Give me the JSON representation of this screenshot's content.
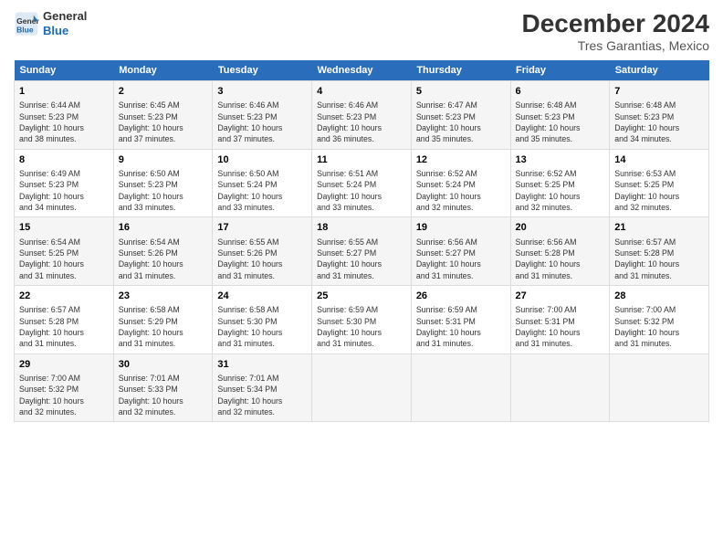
{
  "logo": {
    "line1": "General",
    "line2": "Blue"
  },
  "title": "December 2024",
  "subtitle": "Tres Garantias, Mexico",
  "weekdays": [
    "Sunday",
    "Monday",
    "Tuesday",
    "Wednesday",
    "Thursday",
    "Friday",
    "Saturday"
  ],
  "weeks": [
    [
      {
        "day": "1",
        "info": "Sunrise: 6:44 AM\nSunset: 5:23 PM\nDaylight: 10 hours\nand 38 minutes."
      },
      {
        "day": "2",
        "info": "Sunrise: 6:45 AM\nSunset: 5:23 PM\nDaylight: 10 hours\nand 37 minutes."
      },
      {
        "day": "3",
        "info": "Sunrise: 6:46 AM\nSunset: 5:23 PM\nDaylight: 10 hours\nand 37 minutes."
      },
      {
        "day": "4",
        "info": "Sunrise: 6:46 AM\nSunset: 5:23 PM\nDaylight: 10 hours\nand 36 minutes."
      },
      {
        "day": "5",
        "info": "Sunrise: 6:47 AM\nSunset: 5:23 PM\nDaylight: 10 hours\nand 35 minutes."
      },
      {
        "day": "6",
        "info": "Sunrise: 6:48 AM\nSunset: 5:23 PM\nDaylight: 10 hours\nand 35 minutes."
      },
      {
        "day": "7",
        "info": "Sunrise: 6:48 AM\nSunset: 5:23 PM\nDaylight: 10 hours\nand 34 minutes."
      }
    ],
    [
      {
        "day": "8",
        "info": "Sunrise: 6:49 AM\nSunset: 5:23 PM\nDaylight: 10 hours\nand 34 minutes."
      },
      {
        "day": "9",
        "info": "Sunrise: 6:50 AM\nSunset: 5:23 PM\nDaylight: 10 hours\nand 33 minutes."
      },
      {
        "day": "10",
        "info": "Sunrise: 6:50 AM\nSunset: 5:24 PM\nDaylight: 10 hours\nand 33 minutes."
      },
      {
        "day": "11",
        "info": "Sunrise: 6:51 AM\nSunset: 5:24 PM\nDaylight: 10 hours\nand 33 minutes."
      },
      {
        "day": "12",
        "info": "Sunrise: 6:52 AM\nSunset: 5:24 PM\nDaylight: 10 hours\nand 32 minutes."
      },
      {
        "day": "13",
        "info": "Sunrise: 6:52 AM\nSunset: 5:25 PM\nDaylight: 10 hours\nand 32 minutes."
      },
      {
        "day": "14",
        "info": "Sunrise: 6:53 AM\nSunset: 5:25 PM\nDaylight: 10 hours\nand 32 minutes."
      }
    ],
    [
      {
        "day": "15",
        "info": "Sunrise: 6:54 AM\nSunset: 5:25 PM\nDaylight: 10 hours\nand 31 minutes."
      },
      {
        "day": "16",
        "info": "Sunrise: 6:54 AM\nSunset: 5:26 PM\nDaylight: 10 hours\nand 31 minutes."
      },
      {
        "day": "17",
        "info": "Sunrise: 6:55 AM\nSunset: 5:26 PM\nDaylight: 10 hours\nand 31 minutes."
      },
      {
        "day": "18",
        "info": "Sunrise: 6:55 AM\nSunset: 5:27 PM\nDaylight: 10 hours\nand 31 minutes."
      },
      {
        "day": "19",
        "info": "Sunrise: 6:56 AM\nSunset: 5:27 PM\nDaylight: 10 hours\nand 31 minutes."
      },
      {
        "day": "20",
        "info": "Sunrise: 6:56 AM\nSunset: 5:28 PM\nDaylight: 10 hours\nand 31 minutes."
      },
      {
        "day": "21",
        "info": "Sunrise: 6:57 AM\nSunset: 5:28 PM\nDaylight: 10 hours\nand 31 minutes."
      }
    ],
    [
      {
        "day": "22",
        "info": "Sunrise: 6:57 AM\nSunset: 5:28 PM\nDaylight: 10 hours\nand 31 minutes."
      },
      {
        "day": "23",
        "info": "Sunrise: 6:58 AM\nSunset: 5:29 PM\nDaylight: 10 hours\nand 31 minutes."
      },
      {
        "day": "24",
        "info": "Sunrise: 6:58 AM\nSunset: 5:30 PM\nDaylight: 10 hours\nand 31 minutes."
      },
      {
        "day": "25",
        "info": "Sunrise: 6:59 AM\nSunset: 5:30 PM\nDaylight: 10 hours\nand 31 minutes."
      },
      {
        "day": "26",
        "info": "Sunrise: 6:59 AM\nSunset: 5:31 PM\nDaylight: 10 hours\nand 31 minutes."
      },
      {
        "day": "27",
        "info": "Sunrise: 7:00 AM\nSunset: 5:31 PM\nDaylight: 10 hours\nand 31 minutes."
      },
      {
        "day": "28",
        "info": "Sunrise: 7:00 AM\nSunset: 5:32 PM\nDaylight: 10 hours\nand 31 minutes."
      }
    ],
    [
      {
        "day": "29",
        "info": "Sunrise: 7:00 AM\nSunset: 5:32 PM\nDaylight: 10 hours\nand 32 minutes."
      },
      {
        "day": "30",
        "info": "Sunrise: 7:01 AM\nSunset: 5:33 PM\nDaylight: 10 hours\nand 32 minutes."
      },
      {
        "day": "31",
        "info": "Sunrise: 7:01 AM\nSunset: 5:34 PM\nDaylight: 10 hours\nand 32 minutes."
      },
      {
        "day": "",
        "info": ""
      },
      {
        "day": "",
        "info": ""
      },
      {
        "day": "",
        "info": ""
      },
      {
        "day": "",
        "info": ""
      }
    ]
  ]
}
